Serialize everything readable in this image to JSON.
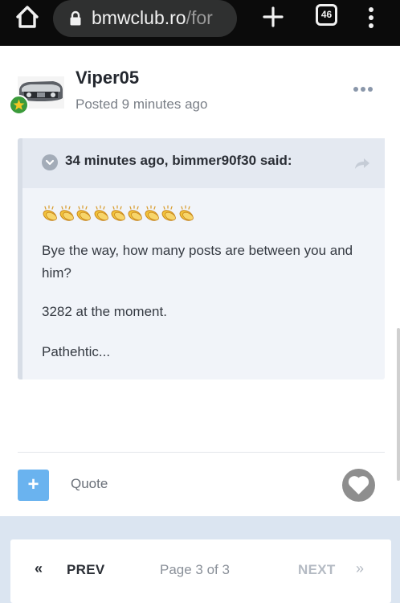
{
  "browser": {
    "url_domain": "bmwclub.ro",
    "url_path": "/for",
    "tab_count": "46"
  },
  "post": {
    "author": "Viper05",
    "meta": "Posted 9 minutes ago",
    "quote": {
      "attribution": "34 minutes ago, bimmer90f30 said:",
      "emoji": "clapping-hands",
      "emoji_count": 9,
      "lines": [
        "Bye the way, how many posts are between you and him?",
        "3282 at the moment.",
        "Pathehtic..."
      ]
    }
  },
  "actions": {
    "multiquote_label": "+",
    "quote_label": "Quote"
  },
  "pagination": {
    "prev_icon": "«",
    "prev_label": "PREV",
    "status": "Page 3 of 3",
    "next_label": "NEXT",
    "next_icon": "»"
  },
  "colors": {
    "accent": "#6ab3ef",
    "pager_band": "#dbe5f1",
    "quote_background": "#f1f4f9",
    "rank_badge": "#3b9b3b"
  },
  "icons": [
    "home-icon",
    "lock-icon",
    "plus-icon",
    "tabs-icon",
    "overflow-menu-icon",
    "post-options-icon",
    "quote-caret-icon",
    "share-icon",
    "heart-icon"
  ]
}
